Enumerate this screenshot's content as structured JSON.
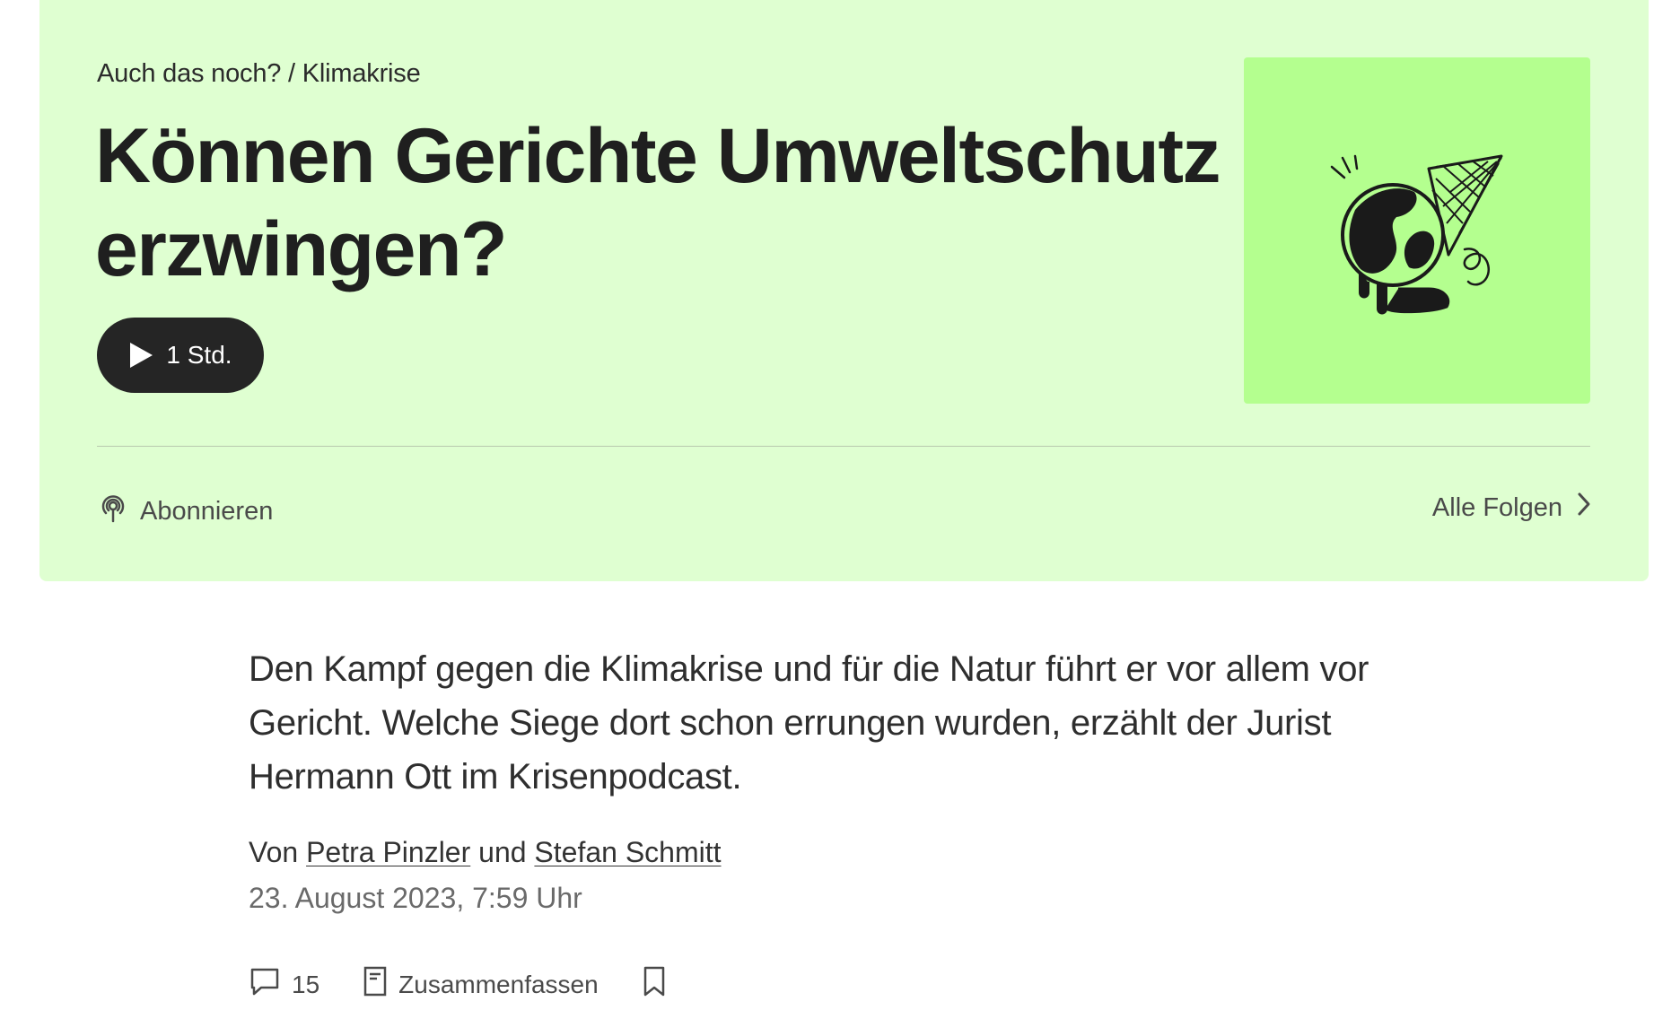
{
  "hero": {
    "kicker": "Auch das noch? / Klimakrise",
    "title": "Können Gerichte Umweltschutz erzwingen?",
    "play_duration": "1 Std.",
    "subscribe_label": "Abonnieren",
    "all_episodes_label": "Alle Folgen",
    "background_color": "#dfffd1",
    "cover_color": "#b4ff8f"
  },
  "article": {
    "summary": "Den Kampf gegen die Klimakrise und für die Natur führt er vor allem vor Gericht. Welche Siege dort schon errungen wurden, erzählt der Jurist Hermann Ott im Krisenpodcast.",
    "byline_prefix": "Von",
    "author_1": "Petra Pinzler",
    "byline_conjunction": "und",
    "author_2": "Stefan Schmitt",
    "date": "23. August 2023, 7:59 Uhr"
  },
  "actions": {
    "comments_count": "15",
    "summarize_label": "Zusammenfassen"
  },
  "icons": {
    "play": "play-icon",
    "podcast": "podcast-icon",
    "chevron": "chevron-right-icon",
    "comment": "comment-icon",
    "document": "document-icon",
    "bookmark": "bookmark-icon",
    "cover": "melting-ice-cream-globe-illustration"
  }
}
